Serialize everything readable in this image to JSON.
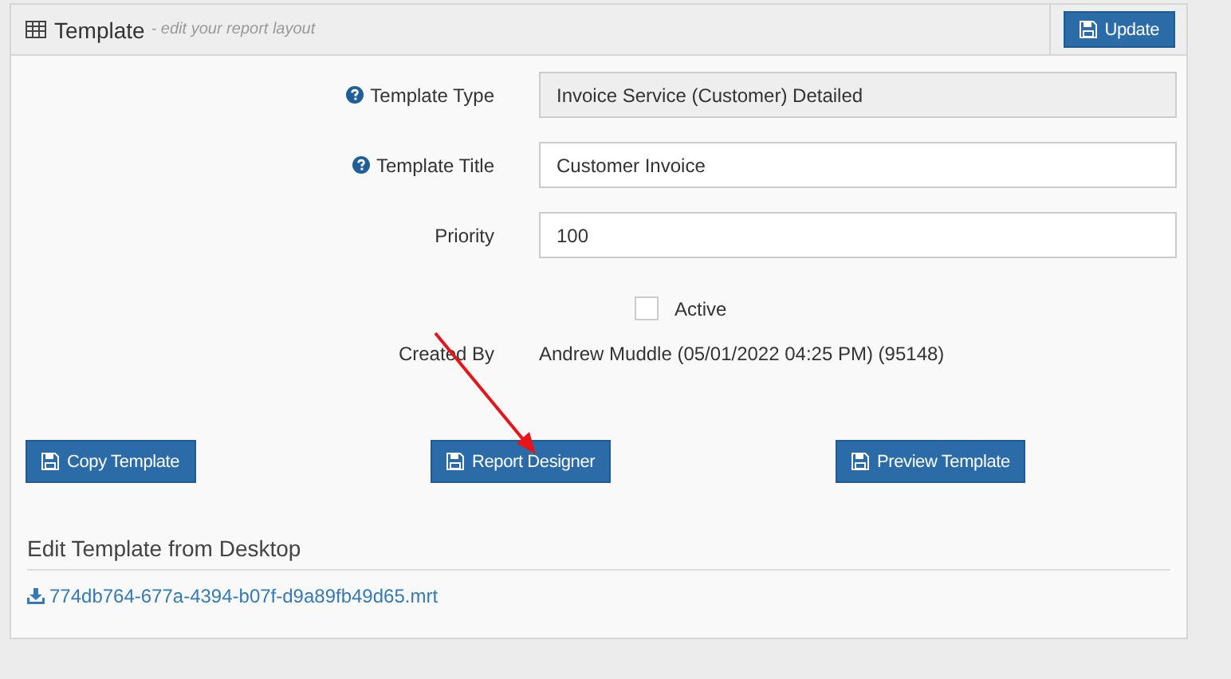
{
  "panel": {
    "title": "Template",
    "subtitle": "- edit your report layout",
    "action": "Update"
  },
  "fields": [
    {
      "label": "Template Type",
      "help": true,
      "kind": "readonly",
      "value": "Invoice Service (Customer) Detailed"
    },
    {
      "label": "Template Title",
      "help": true,
      "kind": "input",
      "value": "Customer Invoice"
    },
    {
      "label": "Priority",
      "help": false,
      "kind": "input",
      "value": "100"
    }
  ],
  "active": {
    "label": "Active",
    "checked": false
  },
  "created_by": {
    "label": "Created By",
    "value": "Andrew Muddle (05/01/2022 04:25 PM) (95148)"
  },
  "buttons": [
    "Copy Template",
    "Report Designer",
    "Preview Template"
  ],
  "desktop": {
    "heading": "Edit Template from Desktop",
    "link": "774db764-677a-4394-b07f-d9a89fb49d65.mrt"
  }
}
